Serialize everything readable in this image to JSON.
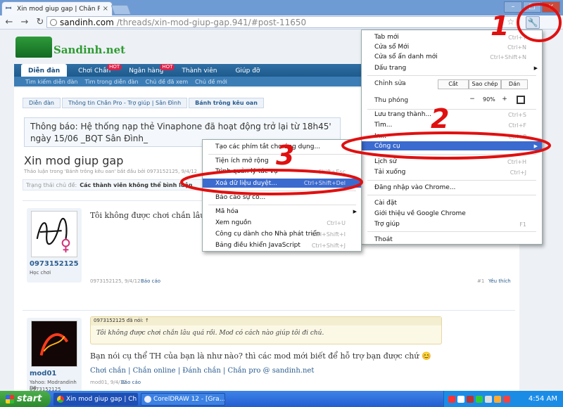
{
  "browser": {
    "tab_title": "Xin mod giup gap | Chắn Pro @ sandinh.com",
    "tab_close": "×",
    "url_host": "sandinh.com",
    "url_path": "/threads/xin-mod-giup-gap.941/#post-11650",
    "win_min": "–",
    "win_max": "□",
    "win_close": "×"
  },
  "site": {
    "logo": "Sandinh.net",
    "nav": [
      {
        "label": "Diễn đàn"
      },
      {
        "label": "Chơi Chắn",
        "badge": "HOT"
      },
      {
        "label": "Ngân hàng",
        "badge": "HOT"
      },
      {
        "label": "Thành viên"
      },
      {
        "label": "Giúp đỡ"
      }
    ],
    "subnav": [
      "Tìm kiếm diễn đàn",
      "Tìm trong diễn đàn",
      "Chủ đề đã xem",
      "Chủ đề mới"
    ],
    "breadcrumb": [
      "Diễn đàn",
      "Thông tin Chắn Pro - Trợ giúp | Sân Đình",
      "Bánh trông kêu oan"
    ],
    "notice": "Thông báo: Hệ thống nạp thẻ Vinaphone đã hoạt động trở lại từ 18h45' ngày 15/06 _BQT Sân Đình_",
    "thread_title": "Xin mod giup gap",
    "thread_meta": "Thảo luận trong 'Bánh trông kêu oan' bắt đầu bởi 0973152125, 9/4/12",
    "status_label": "Trạng thái chủ đề:",
    "status_value": "Các thành viên không thể bình luận"
  },
  "posts": [
    {
      "username": "0973152125",
      "usertitle": "Học chơi",
      "text": "Tôi không được chơi chắn lâu quá rồi. Mod có cách nào giúp tôi đi chú.",
      "date": "0973152125, 9/4/12",
      "report": "Báo cáo",
      "num": "#1",
      "like": "Yêu thích"
    },
    {
      "username": "mod01",
      "usertitle": "Yahoo: Modrandinh D8",
      "usertitle2": "0973152125",
      "quote_head": "0973152125 đã nói: ↑",
      "quote_body": "Tôi không được chơi chắn lâu quá rồi. Mod có cách nào giúp tôi đi chú.",
      "text": "Bạn nói cụ thể TH của bạn là như nào? thì các mod mới biết để hỗ trợ bạn được chứ 😊",
      "sig": "Chơi chắn | Chắn online | Đánh chắn | Chắn pro @ sandinh.net",
      "date": "mod01, 9/4/12",
      "report": "Báo cáo"
    }
  ],
  "menu": {
    "items": [
      {
        "label": "Tab mới",
        "shortcut": "Ctrl+T"
      },
      {
        "label": "Cửa sổ Mới",
        "shortcut": "Ctrl+N"
      },
      {
        "label": "Cửa sổ ẩn danh mới",
        "shortcut": "Ctrl+Shift+N"
      },
      {
        "label": "Dấu trang",
        "arrow": "▶"
      }
    ],
    "edit_label": "Chỉnh sửa",
    "cut": "Cắt",
    "copy": "Sao chép",
    "paste": "Dán",
    "zoom_label": "Thu phóng",
    "zoom_minus": "−",
    "zoom_value": "90%",
    "zoom_plus": "+",
    "items2": [
      {
        "label": "Lưu trang thành...",
        "shortcut": "Ctrl+S"
      },
      {
        "label": "Tìm...",
        "shortcut": "Ctrl+F"
      },
      {
        "label": "In...",
        "shortcut": "Ctrl+P"
      }
    ],
    "tools": {
      "label": "Công cụ",
      "arrow": "▶"
    },
    "items3": [
      {
        "label": "Lịch sử",
        "shortcut": "Ctrl+H"
      },
      {
        "label": "Tải xuống",
        "shortcut": "Ctrl+J"
      }
    ],
    "signin": "Đăng nhập vào Chrome...",
    "items4": [
      {
        "label": "Cài đặt"
      },
      {
        "label": "Giới thiệu về Google Chrome"
      },
      {
        "label": "Trợ giúp",
        "shortcut": "F1"
      }
    ],
    "exit": "Thoát"
  },
  "submenu": {
    "items": [
      {
        "label": "Tạo các phím tắt cho ứng dụng..."
      },
      {
        "label": "Tiện ích mở rộng"
      },
      {
        "label": "Trình quản lý tác vụ",
        "shortcut": "Shift+Esc"
      },
      {
        "label": "Xoá dữ liệu duyệt...",
        "shortcut": "Ctrl+Shift+Del"
      },
      {
        "label": "Báo cáo sự cố..."
      },
      {
        "label": "Mã hóa",
        "arrow": "▶"
      },
      {
        "label": "Xem nguồn",
        "shortcut": "Ctrl+U"
      },
      {
        "label": "Công cụ dành cho Nhà phát triển",
        "shortcut": "Ctrl+Shift+I"
      },
      {
        "label": "Bảng điều khiển JavaScript",
        "shortcut": "Ctrl+Shift+J"
      }
    ]
  },
  "annotations": [
    "1",
    "2",
    "3"
  ],
  "taskbar": {
    "start": "start",
    "tasks": [
      "Xin mod giup gap | Ch...",
      "CorelDRAW 12 - [Gra..."
    ],
    "clock": "4:54 AM"
  },
  "colors": {
    "annotation": "#e01010",
    "menu_highlight": "#3b6bcf",
    "nav_blue": "#1e5a8c"
  }
}
